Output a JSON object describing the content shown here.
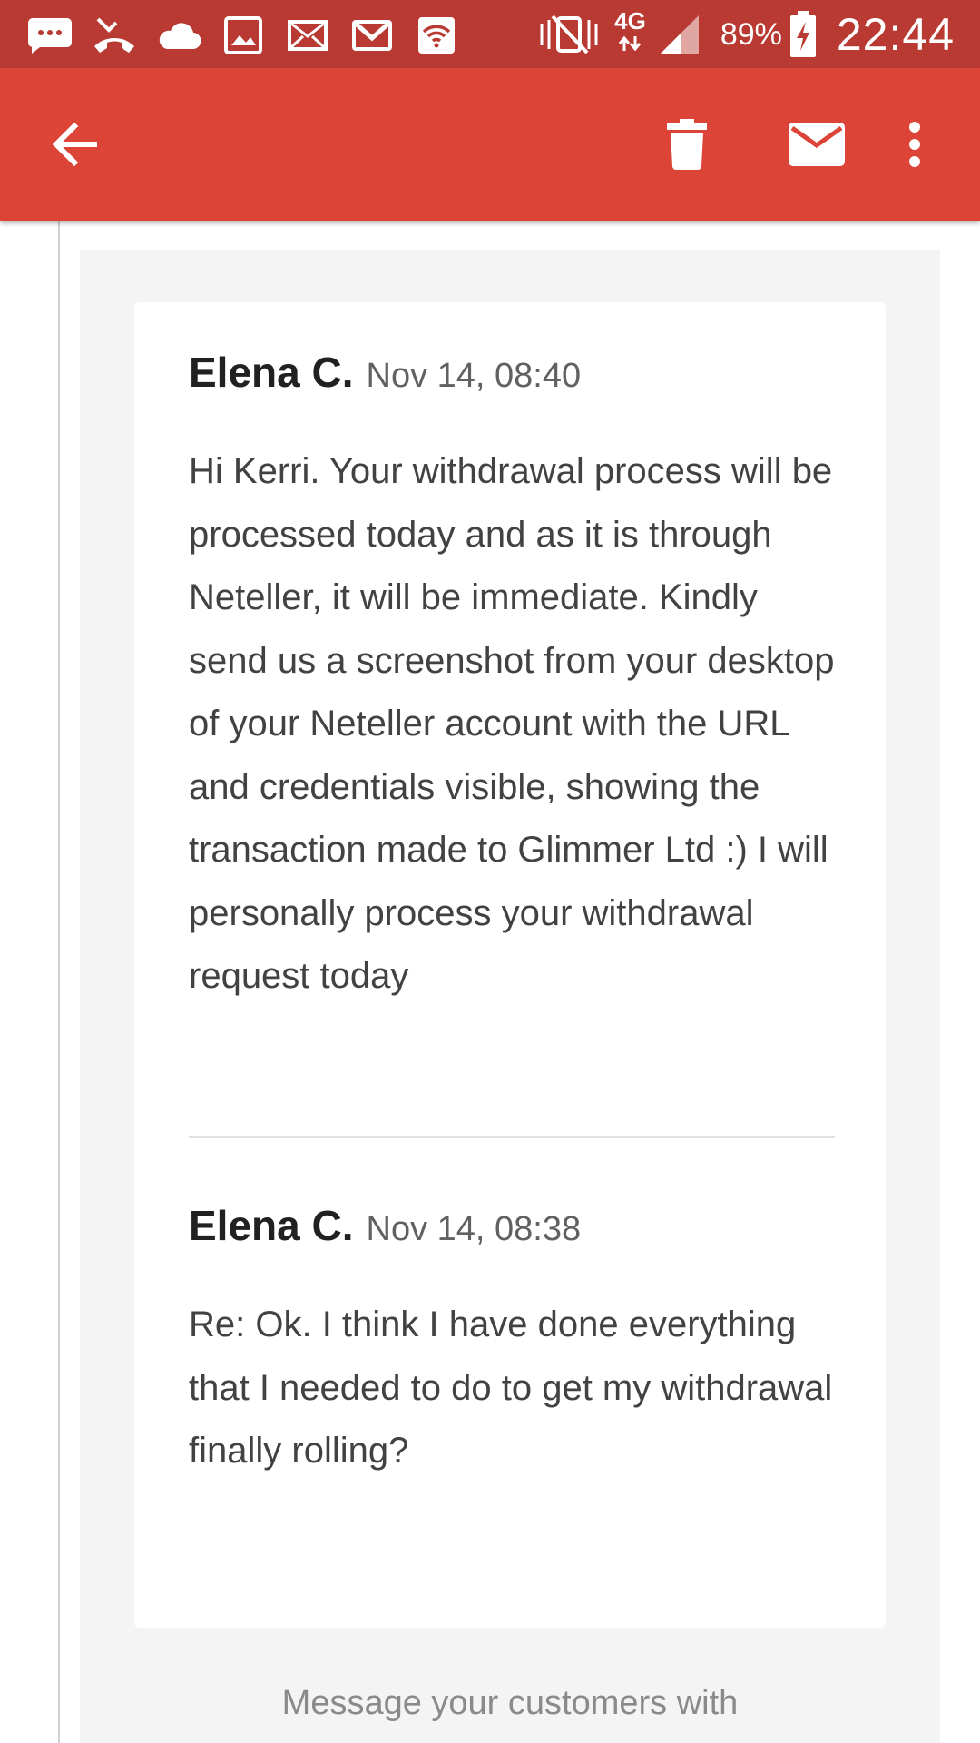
{
  "status_bar": {
    "network_type": "4G",
    "battery_percent": "89%",
    "time": "22:44",
    "left_icons": [
      "sms-icon",
      "missed-call-icon",
      "cloud-icon",
      "image-icon",
      "email-icon",
      "gmail-icon",
      "wifi-icon"
    ],
    "right_icons": [
      "vibrate-icon",
      "data-arrows-icon",
      "signal-icon",
      "battery-charging-icon"
    ]
  },
  "app_bar": {
    "color": "#db4437",
    "status_color": "#b93a32",
    "actions": [
      "arrow-back-icon",
      "trash-icon",
      "mail-icon",
      "more-vert-icon"
    ]
  },
  "messages": [
    {
      "sender": "Elena C.",
      "timestamp": "Nov 14, 08:40",
      "body": "Hi Kerri. Your withdrawal process will be processed today and as it is through Neteller, it will be immediate. Kindly send us a screenshot from your desktop of your Neteller account with the URL and credentials visible, showing the transaction made to Glimmer Ltd :) I will personally process your withdrawal request today"
    },
    {
      "sender": "Elena C.",
      "timestamp": "Nov 14, 08:38",
      "body": "Re: Ok. I think I have done everything that I needed to do to get my withdrawal finally rolling?"
    }
  ],
  "footer": {
    "text": "Message your customers with"
  }
}
